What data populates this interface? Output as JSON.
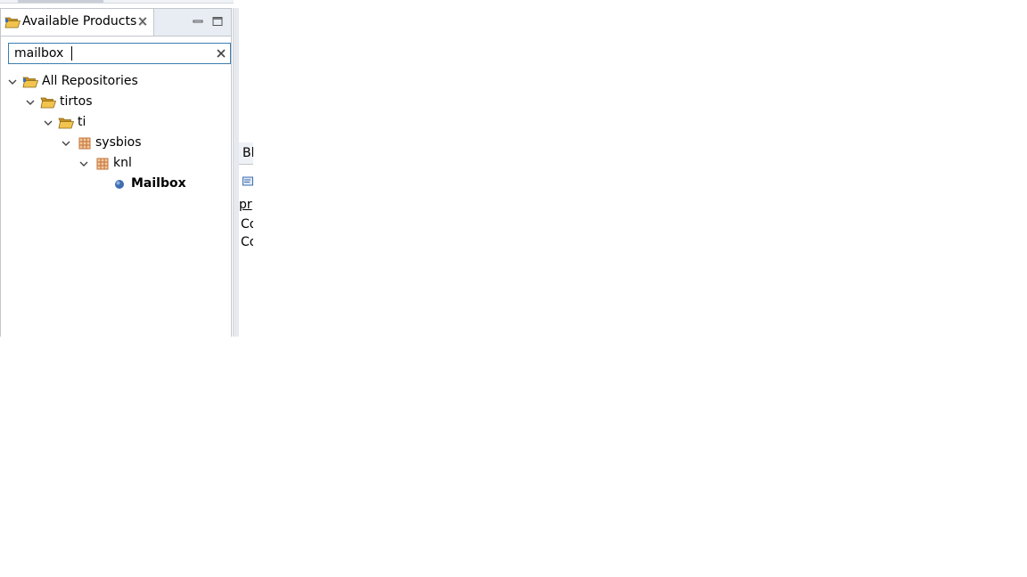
{
  "panel": {
    "tab_title": "Available Products",
    "tab_icon": "folder-open-icon",
    "close_icon": "close-icon",
    "minimize_icon": "minimize-icon",
    "maximize_icon": "maximize-icon"
  },
  "search": {
    "value": "mailbox",
    "clear_icon": "clear-x-icon"
  },
  "tree": [
    {
      "label": "All Repositories",
      "level": 0,
      "expanded": true,
      "icon": "folder-open-icon",
      "bold": false
    },
    {
      "label": "tirtos",
      "level": 1,
      "expanded": true,
      "icon": "folder-open-icon",
      "bold": false
    },
    {
      "label": "ti",
      "level": 2,
      "expanded": true,
      "icon": "folder-open-icon",
      "bold": false
    },
    {
      "label": "sysbios",
      "level": 3,
      "expanded": true,
      "icon": "package-icon",
      "bold": false
    },
    {
      "label": "knl",
      "level": 4,
      "expanded": true,
      "icon": "package-icon",
      "bold": false
    },
    {
      "label": "Mailbox",
      "level": 5,
      "expanded": null,
      "icon": "module-dot-icon",
      "bold": true
    }
  ],
  "right_panel": {
    "tab_text": "Bl",
    "lines": [
      "pr",
      "Co",
      "Co"
    ]
  },
  "colors": {
    "accent": "#3c7fb1",
    "tabbar_bg": "#e8edf4",
    "folder": "#e8b23a",
    "package": "#c0703a",
    "module_dot": "#3f6fb0"
  }
}
